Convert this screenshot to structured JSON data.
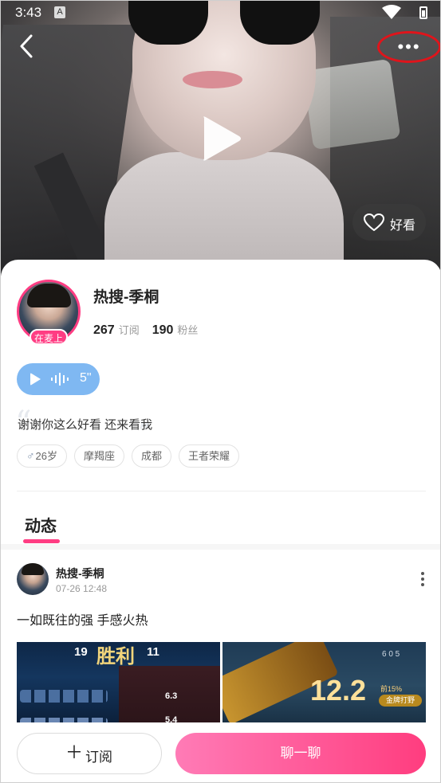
{
  "status_bar": {
    "time": "3:43",
    "notification_letter": "A"
  },
  "hero": {
    "like_label": "好看"
  },
  "profile": {
    "name": "热搜-季桐",
    "mic_badge": "在麦上",
    "subscribe_count": "267",
    "subscribe_label": "订阅",
    "fans_count": "190",
    "fans_label": "粉丝",
    "voice_duration": "5\"",
    "bio": "谢谢你这么好看 还来看我",
    "tags": [
      {
        "icon": "male-icon",
        "gender_symbol": "♂",
        "label": "26岁"
      },
      {
        "label": "摩羯座"
      },
      {
        "label": "成都"
      },
      {
        "label": "王者荣耀"
      }
    ]
  },
  "tabs": {
    "active": "动态"
  },
  "post": {
    "author": "热搜-季桐",
    "time": "07-26 12:48",
    "text": "一如既往的强 手感火热",
    "image1": {
      "score_left": "19",
      "banner": "胜利",
      "score_right": "11",
      "value_a": "6.3",
      "value_b": "5.4"
    },
    "image2": {
      "rating": "12.2",
      "percent": "前15%",
      "badge": "金牌打野",
      "kda": "6  0  5"
    }
  },
  "bottom": {
    "subscribe_label": "订阅",
    "chat_label": "聊一聊"
  },
  "colors": {
    "accent": "#ff3d83",
    "voice_blue": "#7fb8f2",
    "highlight_red": "#e0141b"
  }
}
